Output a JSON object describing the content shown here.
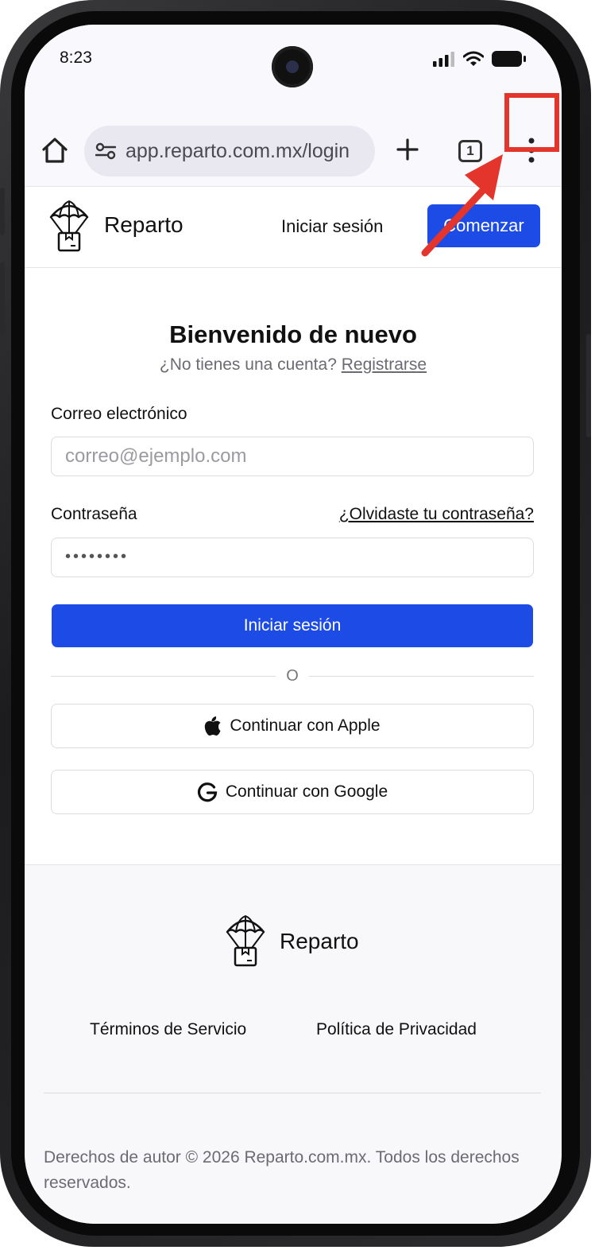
{
  "status_bar": {
    "time": "8:23"
  },
  "browser": {
    "url": "app.reparto.com.mx/login",
    "tab_count": "1"
  },
  "header": {
    "brand": "Reparto",
    "login_link": "Iniciar sesión",
    "cta_button": "Comenzar"
  },
  "login": {
    "title": "Bienvenido de nuevo",
    "subtitle_prefix": "¿No tienes una cuenta?",
    "register_link": "Registrarse",
    "email_label": "Correo electrónico",
    "email_placeholder": "correo@ejemplo.com",
    "password_label": "Contraseña",
    "forgot_link": "¿Olvidaste tu contraseña?",
    "password_value": "••••••••",
    "submit_button": "Iniciar sesión",
    "divider_text": "O",
    "apple_button": "Continuar con Apple",
    "google_button": "Continuar con Google"
  },
  "footer": {
    "brand": "Reparto",
    "terms_link": "Términos de Servicio",
    "privacy_link": "Política de Privacidad",
    "copyright": "Derechos de autor © 2026 Reparto.com.mx. Todos los derechos reservados."
  },
  "colors": {
    "primary": "#1d4be6",
    "highlight": "#e4352d"
  }
}
